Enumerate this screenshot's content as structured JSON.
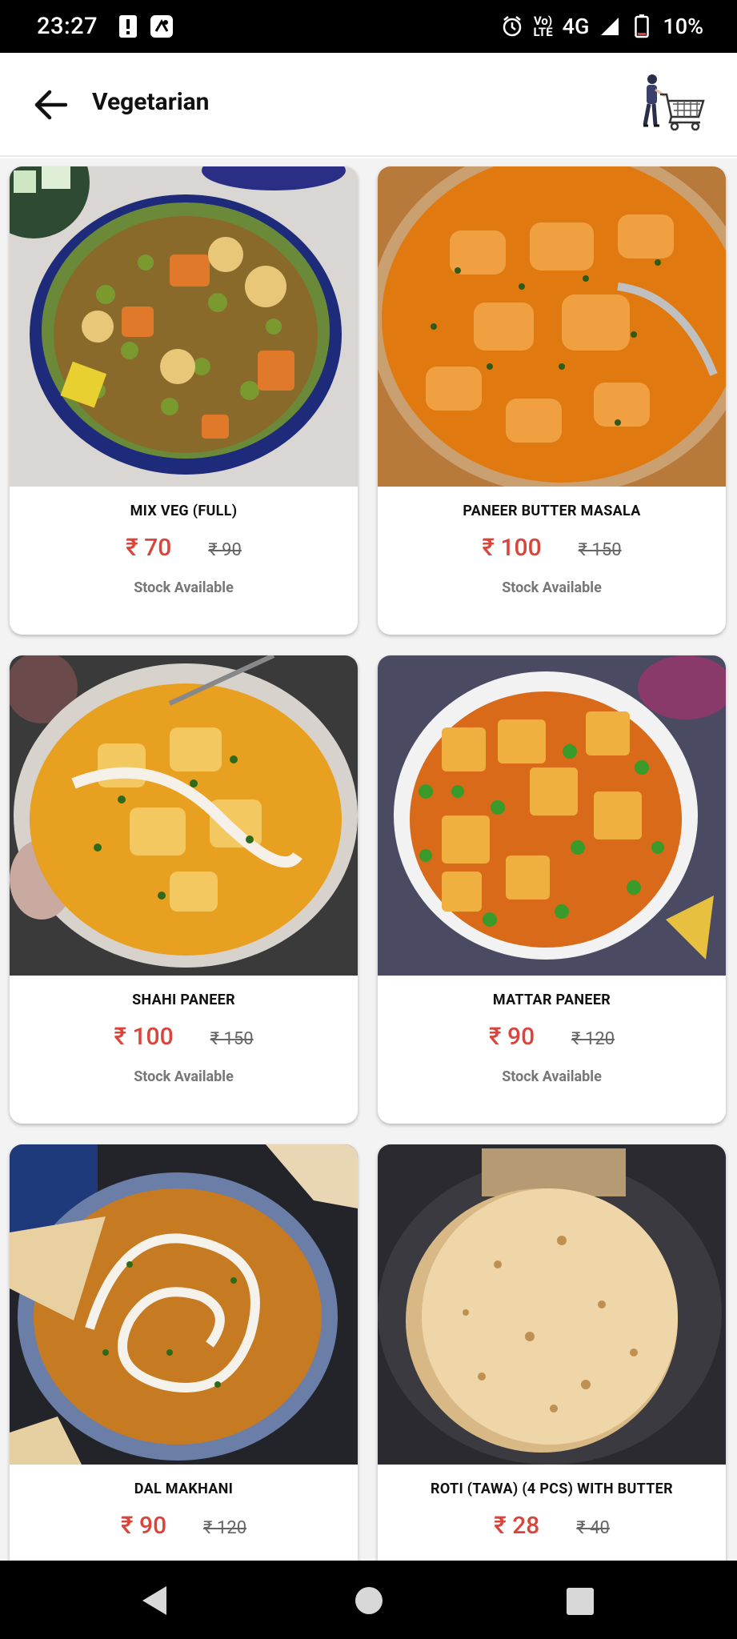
{
  "status_bar": {
    "time": "23:27",
    "network": "4G",
    "volte": "Vo))\nLTE",
    "battery": "10%"
  },
  "app_bar": {
    "title": "Vegetarian"
  },
  "currency": "₹",
  "products": [
    {
      "name": "MIX VEG (FULL)",
      "price": "₹ 70",
      "mrp": "₹ 90",
      "stock": "Stock Available",
      "image": "mix-veg-bowl"
    },
    {
      "name": "PANEER BUTTER MASALA",
      "price": "₹ 100",
      "mrp": "₹ 150",
      "stock": "Stock Available",
      "image": "paneer-butter-masala"
    },
    {
      "name": "SHAHI PANEER",
      "price": "₹ 100",
      "mrp": "₹ 150",
      "stock": "Stock Available",
      "image": "shahi-paneer"
    },
    {
      "name": "MATTAR PANEER",
      "price": "₹ 90",
      "mrp": "₹ 120",
      "stock": "Stock Available",
      "image": "mattar-paneer"
    },
    {
      "name": "DAL MAKHANI",
      "price": "₹ 90",
      "mrp": "₹ 120",
      "stock": "",
      "image": "dal-makhani"
    },
    {
      "name": "ROTI (TAWA) (4 PCS) WITH BUTTER",
      "price": "₹ 28",
      "mrp": "₹ 40",
      "stock": "",
      "image": "roti-stack"
    }
  ],
  "colors": {
    "price": "#d9443b",
    "background": "#f3f3f3"
  }
}
